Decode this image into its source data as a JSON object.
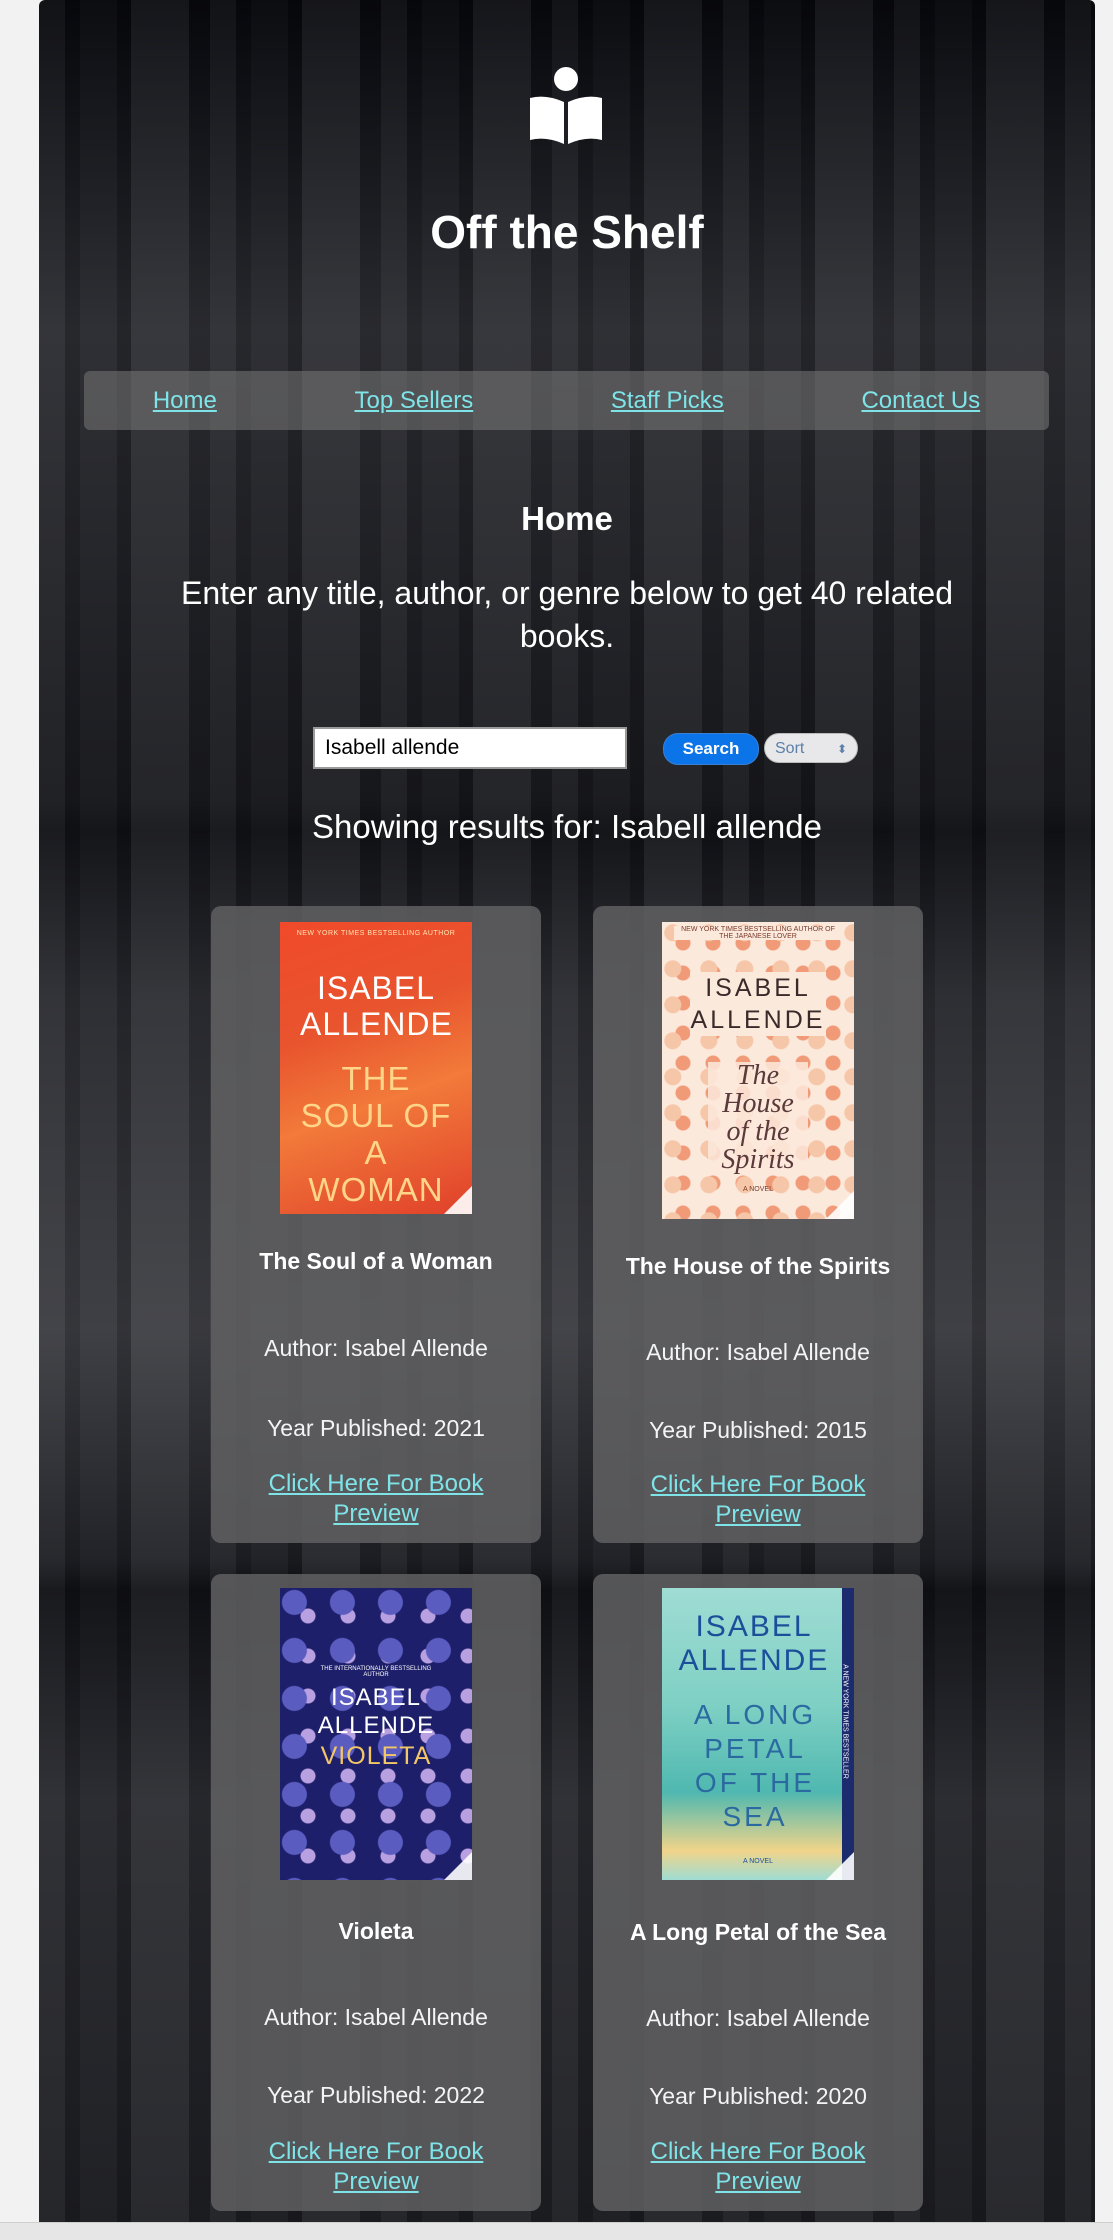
{
  "site": {
    "title": "Off the Shelf",
    "logo_icon": "book-reader-icon"
  },
  "nav": {
    "items": [
      {
        "label": "Home"
      },
      {
        "label": "Top Sellers"
      },
      {
        "label": "Staff Picks"
      },
      {
        "label": "Contact Us"
      }
    ]
  },
  "page": {
    "heading": "Home",
    "intro": "Enter any title, author, or genre below to get 40 related books."
  },
  "search": {
    "value": "Isabell allende",
    "button_label": "Search",
    "sort_label": "Sort"
  },
  "results": {
    "label": "Showing results for: Isabell allende",
    "link_label": "Click Here For Book Preview",
    "books": [
      {
        "title": "The Soul of a Woman",
        "author": "Author: Isabel Allende",
        "year": "Year Published: 2021",
        "cover": {
          "top": "NEW YORK TIMES BESTSELLING AUTHOR",
          "author": "ISABEL ALLENDE",
          "title": "THE SOUL OF A WOMAN"
        }
      },
      {
        "title": "The House of the Spirits",
        "author": "Author: Isabel Allende",
        "year": "Year Published: 2015",
        "cover": {
          "top": "NEW YORK TIMES BESTSELLING AUTHOR OF THE JAPANESE LOVER",
          "author": "ISABEL ALLENDE",
          "title": "The House of the Spirits",
          "sub": "A NOVEL"
        }
      },
      {
        "title": "Violeta",
        "author": "Author: Isabel Allende",
        "year": "Year Published: 2022",
        "cover": {
          "top": "THE INTERNATIONALLY BESTSELLING AUTHOR",
          "author": "ISABEL ALLENDE",
          "title": "VIOLETA"
        }
      },
      {
        "title": "A Long Petal of the Sea",
        "author": "Author: Isabel Allende",
        "year": "Year Published: 2020",
        "cover": {
          "top": "A NEW YORK TIMES BESTSELLER",
          "author": "ISABEL ALLENDE",
          "title": "A LONG PETAL OF THE SEA",
          "sub": "A NOVEL"
        }
      }
    ]
  },
  "colors": {
    "link": "#7ee4e8",
    "search_button": "#0a74e8",
    "card_bg": "#5f5f62"
  }
}
